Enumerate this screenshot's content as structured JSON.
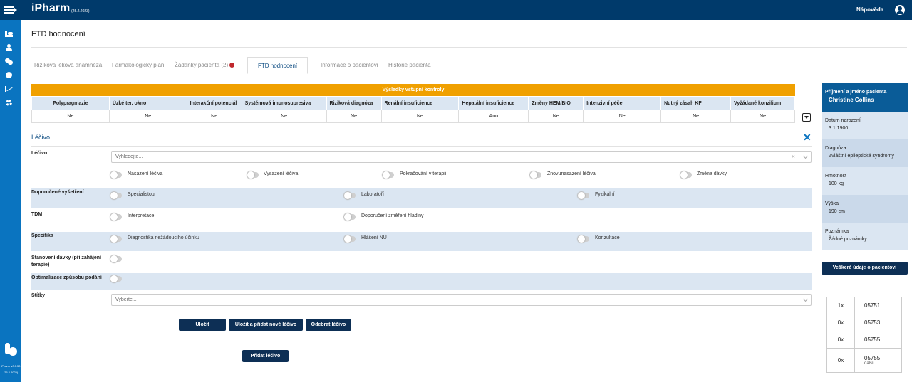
{
  "app": {
    "name": "iPharm",
    "version": "(25.2.2023)",
    "help": "Nápověda"
  },
  "sidebar": {
    "version_line1": "iPharm v0.0.50",
    "version_line2": "(25.2.2023)"
  },
  "page": {
    "title": "FTD hodnocení"
  },
  "tabs": [
    {
      "label": "Riziková léková anamnéza"
    },
    {
      "label": "Farmakologický plán"
    },
    {
      "label": "Žádanky pacienta (2)",
      "badge": "!"
    },
    {
      "label": "FTD hodnocení",
      "active": true
    },
    {
      "label": "Informace o pacientovi"
    },
    {
      "label": "Historie pacienta"
    }
  ],
  "results": {
    "title": "Výsledky vstupní kontroly",
    "columns": [
      {
        "header": "Polypragmazie",
        "value": "Ne"
      },
      {
        "header": "Úzké ter. okno",
        "value": "Ne"
      },
      {
        "header": "Interakční potenciál",
        "value": "Ne"
      },
      {
        "header": "Systémová imunosupresiva",
        "value": "Ne"
      },
      {
        "header": "Riziková diagnóza",
        "value": "Ne"
      },
      {
        "header": "Renální insuficience",
        "value": "Ne"
      },
      {
        "header": "Hepatální insuficience",
        "value": "Ano"
      },
      {
        "header": "Změny HEM/BIO",
        "value": "Ne"
      },
      {
        "header": "Intenzivní péče",
        "value": "Ne"
      },
      {
        "header": "Nutný zásah KF",
        "value": "Ne"
      },
      {
        "header": "Vyžádané konzilium",
        "value": "Ne"
      }
    ]
  },
  "form": {
    "section_title": "Léčivo",
    "drug_label": "Léčivo",
    "drug_placeholder": "Vyhledejte...",
    "drug_options": [
      "Nasazení léčiva",
      "Vysazení léčiva",
      "Pokračování v terapii",
      "Znovunasazení léčiva",
      "Změna dávky"
    ],
    "exams_label": "Doporučené vyšetření",
    "exams_options": [
      "Specialistou",
      "Laboratoří",
      "Fyzikální"
    ],
    "tdm_label": "TDM",
    "tdm_options": [
      "Interpretace",
      "Doporučení změření hladiny"
    ],
    "spec_label": "Specifika",
    "spec_options": [
      "Diagnostika nežádoucího účinku",
      "Hlášení NÚ",
      "Konzultace"
    ],
    "dose_label": "Stanovení dávky (při zahájení terapie)",
    "route_label": "Optimalizace způsobu podání",
    "tags_label": "Štítky",
    "tags_placeholder": "Vyberte..."
  },
  "buttons": {
    "save": "Uložit",
    "save_add": "Uložit a přidat nové léčivo",
    "remove": "Odebrat léčivo",
    "add": "Přidat léčivo"
  },
  "patient": {
    "name_label": "Příjmení a jméno pacienta",
    "name": "Christine Collins",
    "fields": [
      {
        "label": "Datum narození",
        "value": "3.1.1900"
      },
      {
        "label": "Diagnóza",
        "value": "Zvláštní epileptické syndromy"
      },
      {
        "label": "Hmotnost",
        "value": "100 kg"
      },
      {
        "label": "Výška",
        "value": "190 cm"
      },
      {
        "label": "Poznámka",
        "value": "Žádné poznámky"
      }
    ],
    "all_data_button": "Veškeré údaje o pacientovi"
  },
  "codes": [
    {
      "count": "1x",
      "code": "05751"
    },
    {
      "count": "0x",
      "code": "05753"
    },
    {
      "count": "0x",
      "code": "05755"
    },
    {
      "count": "0x",
      "code": "05755",
      "sub": "další"
    }
  ]
}
